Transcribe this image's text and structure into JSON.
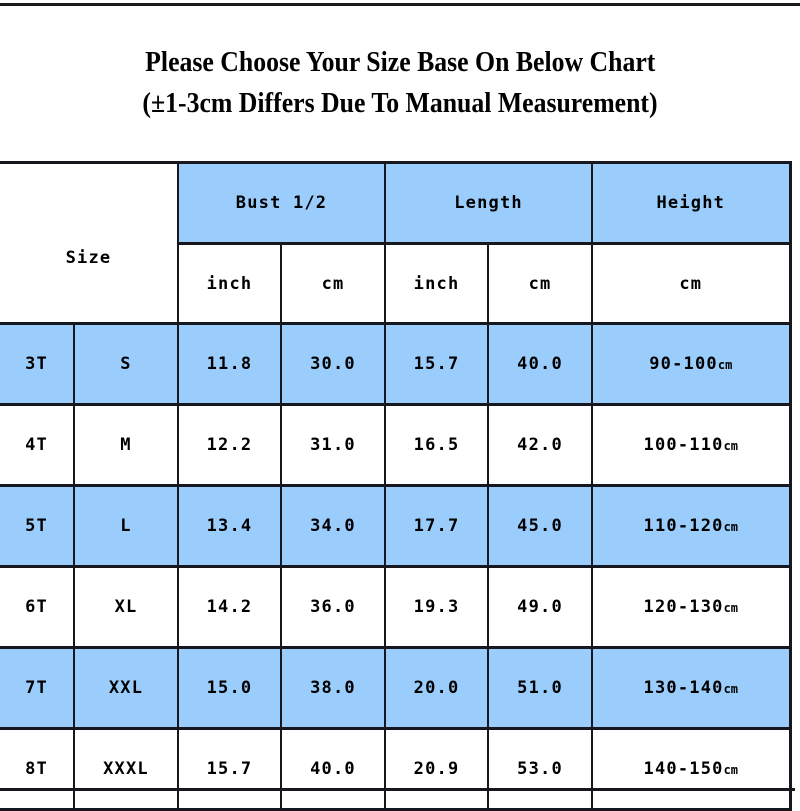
{
  "title": {
    "line1": "Please Choose Your Size Base On Below Chart",
    "line2": "(±1-3cm Differs Due To Manual Measurement)"
  },
  "colors": {
    "highlight_row": "#9acdfc",
    "plain_row": "#ffffff",
    "border": "#17171f",
    "text": "#000000"
  },
  "table": {
    "header": {
      "size_label": "Size",
      "groups": [
        {
          "label": "Bust 1/2",
          "units": [
            "inch",
            "cm"
          ]
        },
        {
          "label": "Length",
          "units": [
            "inch",
            "cm"
          ]
        },
        {
          "label": "Height",
          "units": [
            "cm"
          ]
        }
      ]
    },
    "columns": [
      "Size",
      "Size",
      "Bust 1/2 inch",
      "Bust 1/2 cm",
      "Length inch",
      "Length cm",
      "Height cm"
    ],
    "rows": [
      {
        "age": "3T",
        "letter": "S",
        "bust_inch": "11.8",
        "bust_cm": "30.0",
        "length_inch": "15.7",
        "length_cm": "40.0",
        "height_value": "90-100",
        "height_unit": "cm",
        "highlight": true
      },
      {
        "age": "4T",
        "letter": "M",
        "bust_inch": "12.2",
        "bust_cm": "31.0",
        "length_inch": "16.5",
        "length_cm": "42.0",
        "height_value": "100-110",
        "height_unit": "cm",
        "highlight": false
      },
      {
        "age": "5T",
        "letter": "L",
        "bust_inch": "13.4",
        "bust_cm": "34.0",
        "length_inch": "17.7",
        "length_cm": "45.0",
        "height_value": "110-120",
        "height_unit": "cm",
        "highlight": true
      },
      {
        "age": "6T",
        "letter": "XL",
        "bust_inch": "14.2",
        "bust_cm": "36.0",
        "length_inch": "19.3",
        "length_cm": "49.0",
        "height_value": "120-130",
        "height_unit": "cm",
        "highlight": false
      },
      {
        "age": "7T",
        "letter": "XXL",
        "bust_inch": "15.0",
        "bust_cm": "38.0",
        "length_inch": "20.0",
        "length_cm": "51.0",
        "height_value": "130-140",
        "height_unit": "cm",
        "highlight": true
      },
      {
        "age": "8T",
        "letter": "XXXL",
        "bust_inch": "15.7",
        "bust_cm": "40.0",
        "length_inch": "20.9",
        "length_cm": "53.0",
        "height_value": "140-150",
        "height_unit": "cm",
        "highlight": false
      }
    ]
  }
}
